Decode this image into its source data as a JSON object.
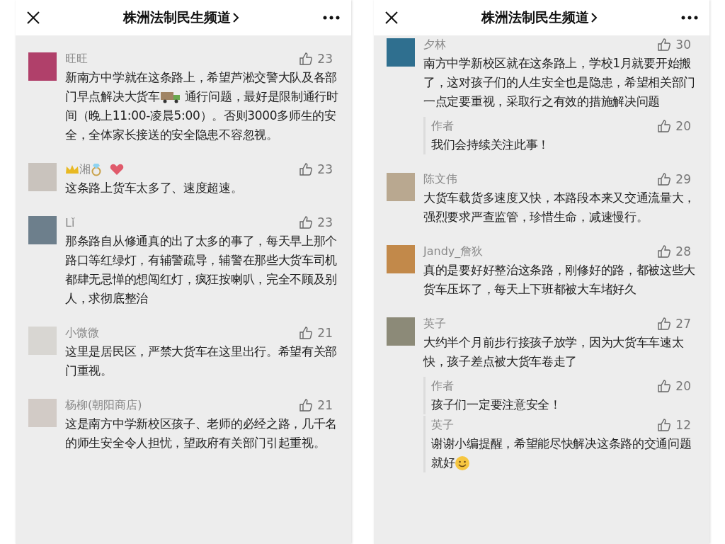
{
  "phones": [
    {
      "title": "株洲法制民生频道",
      "comments": [
        {
          "name": [
            {
              "kind": "text",
              "text": "旺旺"
            }
          ],
          "likes": "23",
          "body": [
            {
              "kind": "text",
              "text": "新南方中学就在这条路上，希望芦淞交警大队及各部门早点解决大货车"
            },
            {
              "kind": "truck"
            },
            {
              "kind": "text",
              "text": " 通行问题，最好是限制通行时间（晚上11:00-凌晨5:00）。否则3000多师生的安全，全体家长接送的安全隐患不容忽视。"
            }
          ]
        },
        {
          "name": [
            {
              "kind": "crown"
            },
            {
              "kind": "text",
              "text": " 湘"
            },
            {
              "kind": "ring"
            },
            {
              "kind": "heart"
            }
          ],
          "likes": "23",
          "body": [
            {
              "kind": "text",
              "text": "这条路上货车太多了、速度超速。"
            }
          ]
        },
        {
          "name": [
            {
              "kind": "text",
              "text": "Lǐ"
            }
          ],
          "likes": "23",
          "body": [
            {
              "kind": "text",
              "text": "那条路自从修通真的出了太多的事了，每天早上那个路口等红绿灯，有辅警疏导，辅警在那些大货车司机都肆无忌惮的想闯红灯，疯狂按喇叭，完全不顾及别人，求彻底整治"
            }
          ]
        },
        {
          "name": [
            {
              "kind": "text",
              "text": "小微微"
            }
          ],
          "likes": "21",
          "body": [
            {
              "kind": "text",
              "text": "这里是居民区，严禁大货车在这里出行。希望有关部门重视。"
            }
          ]
        },
        {
          "name": [
            {
              "kind": "text",
              "text": "杨柳(朝阳商店)"
            }
          ],
          "likes": "21",
          "body": [
            {
              "kind": "text",
              "text": "这是南方中学新校区孩子、老师的必经之路，几千名的师生安全令人担忧，望政府有关部门引起重视。"
            }
          ]
        }
      ]
    },
    {
      "title": "株洲法制民生频道",
      "comments": [
        {
          "name": [
            {
              "kind": "text",
              "text": "夕林"
            }
          ],
          "likes": "30",
          "body": [
            {
              "kind": "text",
              "text": "南方中学新校区就在这条路上，学校1月就要开始搬了，这对孩子们的人生安全也是隐患，希望相关部门一点定要重视，采取行之有效的措施解决问题"
            }
          ],
          "replies": [
            {
              "name": "作者",
              "likes": "20",
              "body": [
                {
                  "kind": "text",
                  "text": "我们会持续关注此事！"
                }
              ]
            }
          ]
        },
        {
          "name": [
            {
              "kind": "text",
              "text": "陈文伟"
            }
          ],
          "likes": "29",
          "body": [
            {
              "kind": "text",
              "text": "大货车载货多速度又快，本路段本来又交通流量大，强烈要求严查监管，珍惜生命，减速慢行。"
            }
          ]
        },
        {
          "name": [
            {
              "kind": "text",
              "text": "Jandy_詹狄"
            }
          ],
          "likes": "28",
          "body": [
            {
              "kind": "text",
              "text": "真的是要好好整治这条路，刚修好的路，都被这些大货车压坏了，每天上下班都被大车堵好久"
            }
          ]
        },
        {
          "name": [
            {
              "kind": "text",
              "text": "英子"
            }
          ],
          "likes": "27",
          "body": [
            {
              "kind": "text",
              "text": "大约半个月前步行接孩子放学，因为大货车车速太快，孩子差点被大货车卷走了"
            }
          ],
          "replies": [
            {
              "name": "作者",
              "likes": "20",
              "body": [
                {
                  "kind": "text",
                  "text": "孩子们一定要注意安全！"
                }
              ]
            },
            {
              "name": "英子",
              "likes": "12",
              "body": [
                {
                  "kind": "text",
                  "text": "谢谢小编提醒，希望能尽快解决这条路的交通问题就好"
                },
                {
                  "kind": "smiley"
                }
              ]
            }
          ]
        }
      ]
    }
  ]
}
